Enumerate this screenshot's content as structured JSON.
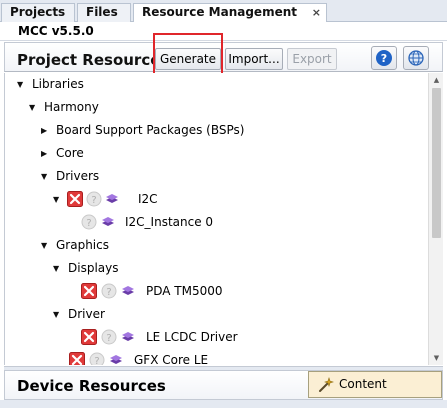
{
  "tabs": [
    {
      "label": "Projects",
      "active": false
    },
    {
      "label": "Files",
      "active": false
    },
    {
      "label": "Resource Management [MCC]",
      "active": true,
      "close": "×"
    }
  ],
  "version": "MCC v5.5.0",
  "project_resources": {
    "title": "Project Resources",
    "buttons": {
      "generate": "Generate",
      "import": "Import...",
      "export": "Export"
    }
  },
  "tree": {
    "libraries": "Libraries",
    "harmony": "Harmony",
    "bsp": "Board Support Packages (BSPs)",
    "core": "Core",
    "drivers": "Drivers",
    "i2c": "I2C",
    "i2c_instance": "I2C_Instance 0",
    "graphics": "Graphics",
    "displays": "Displays",
    "pda": "PDA TM5000",
    "driver": "Driver",
    "lcdc": "LE LCDC Driver",
    "gfx": "GFX Core LE"
  },
  "device_resources": {
    "title": "Device Resources",
    "content_manager": "Content Manager"
  },
  "colors": {
    "accent_red": "#e0262b",
    "remove_red": "#e03a3a",
    "layer_purple": "#8a55c8",
    "help_blue": "#1f63c6"
  }
}
